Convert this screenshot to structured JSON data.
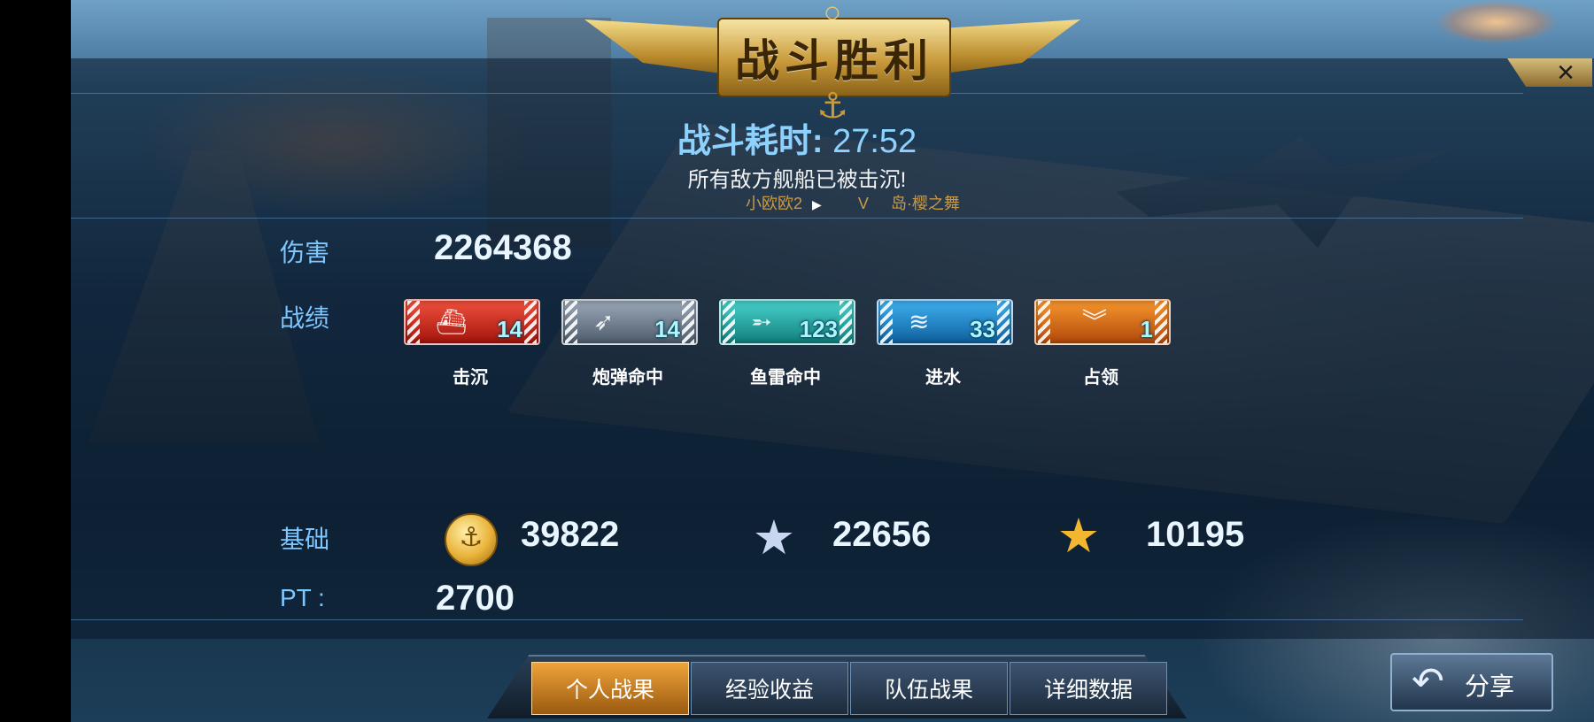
{
  "header": {
    "title": "战斗胜利",
    "battle_time_label": "战斗耗时:",
    "battle_time_value": "27:52",
    "message": "所有敌方舰船已被击沉!",
    "player": "小欧欧2",
    "mode": "V",
    "map": "岛·樱之舞"
  },
  "stats": {
    "damage_label": "伤害",
    "damage_value": "2264368",
    "record_label": "战绩",
    "badges": [
      {
        "label": "击沉",
        "count": "14",
        "color": "#d0281c",
        "icon": "ship-sinking-icon"
      },
      {
        "label": "炮弹命中",
        "count": "14",
        "color": "#6c7b8c",
        "icon": "shell-icon"
      },
      {
        "label": "鱼雷命中",
        "count": "123",
        "color": "#1fa9a6",
        "icon": "torpedo-icon"
      },
      {
        "label": "进水",
        "count": "33",
        "color": "#1e86c8",
        "icon": "flooding-icon"
      },
      {
        "label": "占领",
        "count": "1",
        "color": "#e06a10",
        "icon": "chevron-rank-icon"
      }
    ],
    "base_label": "基础",
    "coins": "39822",
    "silver_star": "22656",
    "gold_star": "10195",
    "pt_label": "PT :",
    "pt_value": "2700"
  },
  "tabs": [
    "个人战果",
    "经验收益",
    "队伍战果",
    "详细数据"
  ],
  "active_tab": 0,
  "share_label": "分享",
  "close_icon": "×"
}
